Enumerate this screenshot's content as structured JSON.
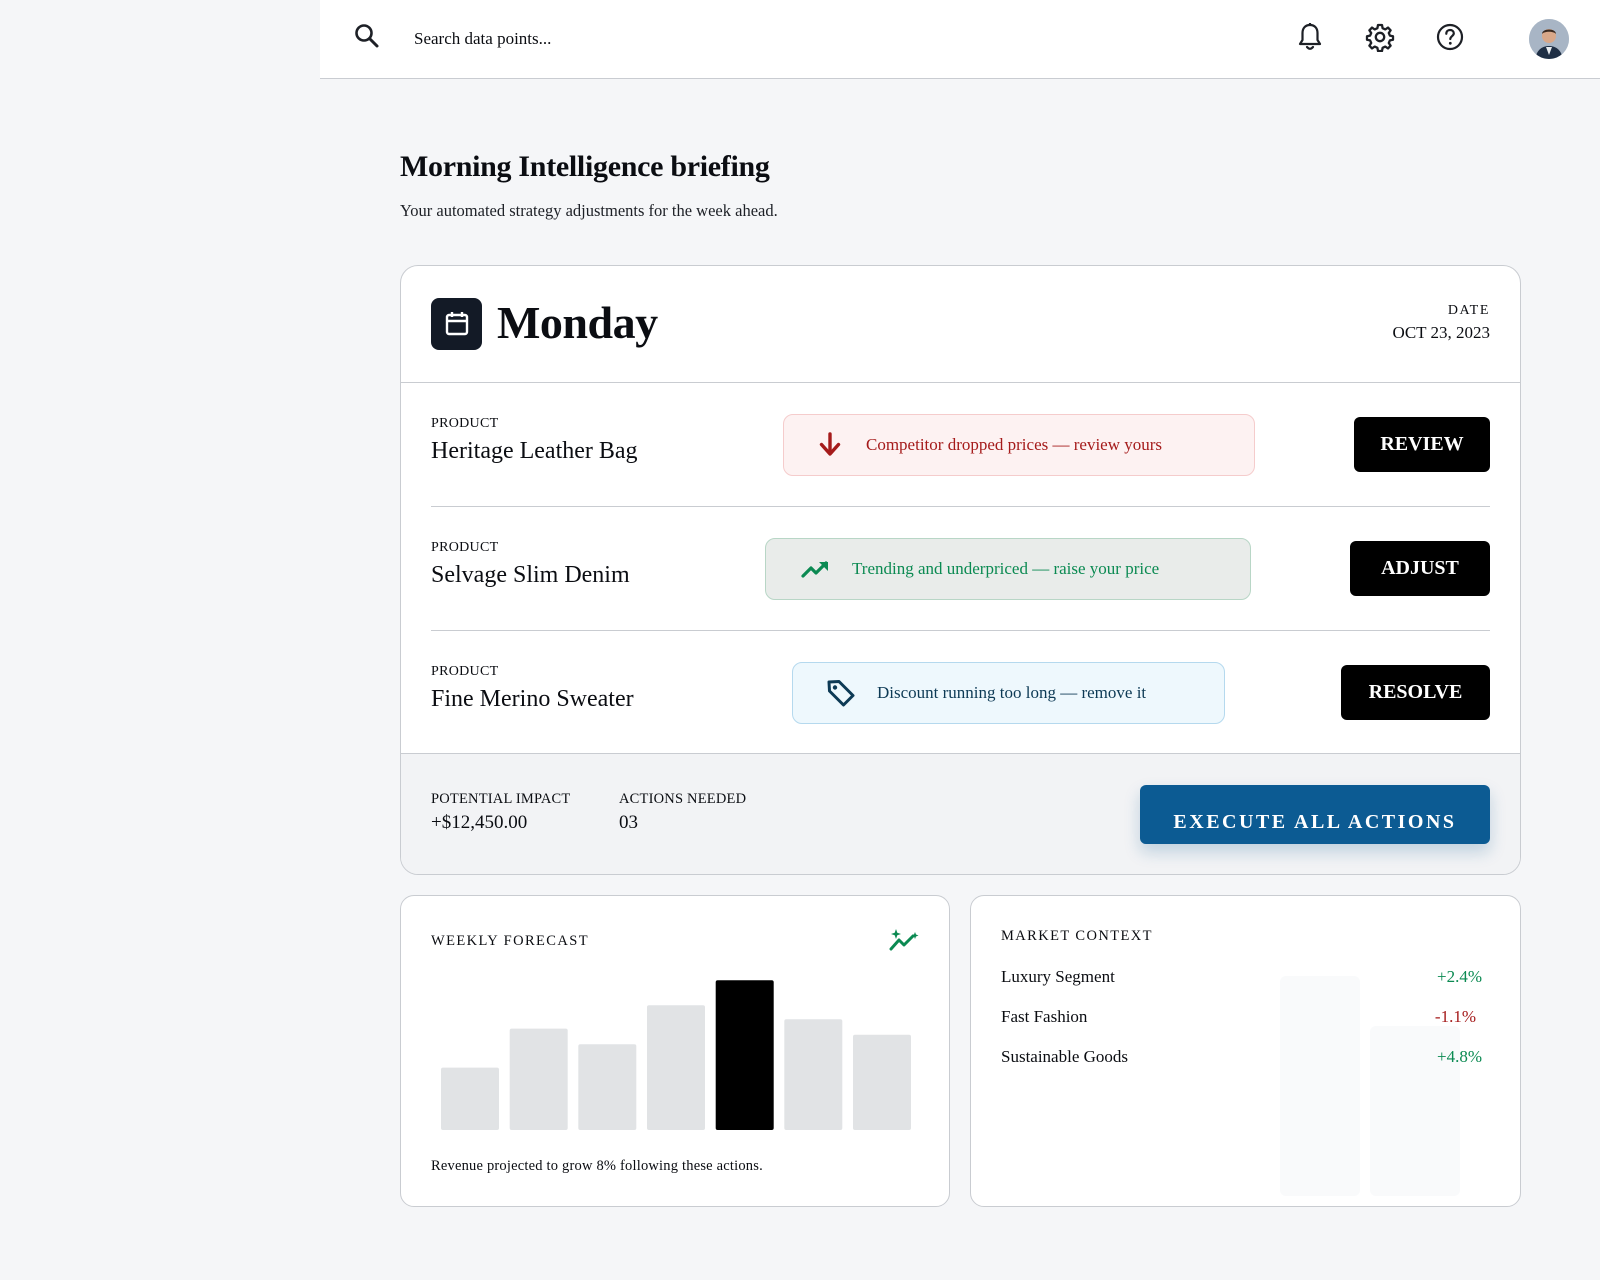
{
  "search": {
    "placeholder": "Search data points..."
  },
  "header": {
    "icons": [
      "bell-icon",
      "gear-icon",
      "help-icon",
      "avatar"
    ]
  },
  "page": {
    "title": "Morning Intelligence briefing",
    "subtitle": "Your automated strategy adjustments for the week ahead."
  },
  "briefing": {
    "day": "Monday",
    "date_label": "DATE",
    "date_value": "OCT 23, 2023",
    "rows": [
      {
        "label": "PRODUCT",
        "name": "Heritage Leather Bag",
        "alert": "Competitor dropped prices — review yours",
        "alert_icon": "arrow-down-icon",
        "action": "REVIEW",
        "tone": "red"
      },
      {
        "label": "PRODUCT",
        "name": "Selvage Slim Denim",
        "alert": "Trending and underpriced — raise your price",
        "alert_icon": "trending-up-icon",
        "action": "ADJUST",
        "tone": "green"
      },
      {
        "label": "PRODUCT",
        "name": "Fine Merino Sweater",
        "alert": "Discount running too long — remove it",
        "alert_icon": "tag-icon",
        "action": "RESOLVE",
        "tone": "blue"
      }
    ],
    "footer": {
      "impact_label": "POTENTIAL IMPACT",
      "impact_value": "+$12,450.00",
      "actions_label": "ACTIONS NEEDED",
      "actions_value": "03",
      "execute_label": "EXECUTE ALL ACTIONS"
    }
  },
  "forecast": {
    "label": "WEEKLY FORECAST",
    "caption": "Revenue projected to grow 8% following these actions.",
    "highlight_color": "#000000",
    "bar_color": "#e1e3e5"
  },
  "chart_data": {
    "type": "bar",
    "categories": [
      "",
      "",
      "",
      "",
      "",
      "",
      ""
    ],
    "values": [
      40,
      65,
      55,
      80,
      96,
      71,
      61
    ],
    "highlight_index": 4,
    "title": "WEEKLY FORECAST",
    "xlabel": "",
    "ylabel": "",
    "ylim": [
      0,
      100
    ],
    "grid": false
  },
  "market": {
    "label": "MARKET CONTEXT",
    "items": [
      {
        "name": "Luxury Segment",
        "value": "+2.4%",
        "trend": "pos"
      },
      {
        "name": "Fast Fashion",
        "value": "-1.1%",
        "trend": "neg"
      },
      {
        "name": "Sustainable Goods",
        "value": "+4.8%",
        "trend": "pos"
      }
    ]
  },
  "colors": {
    "accent": "#0c5b93",
    "positive": "#0b8a52",
    "negative": "#a51b1b",
    "dark": "#131a26"
  }
}
